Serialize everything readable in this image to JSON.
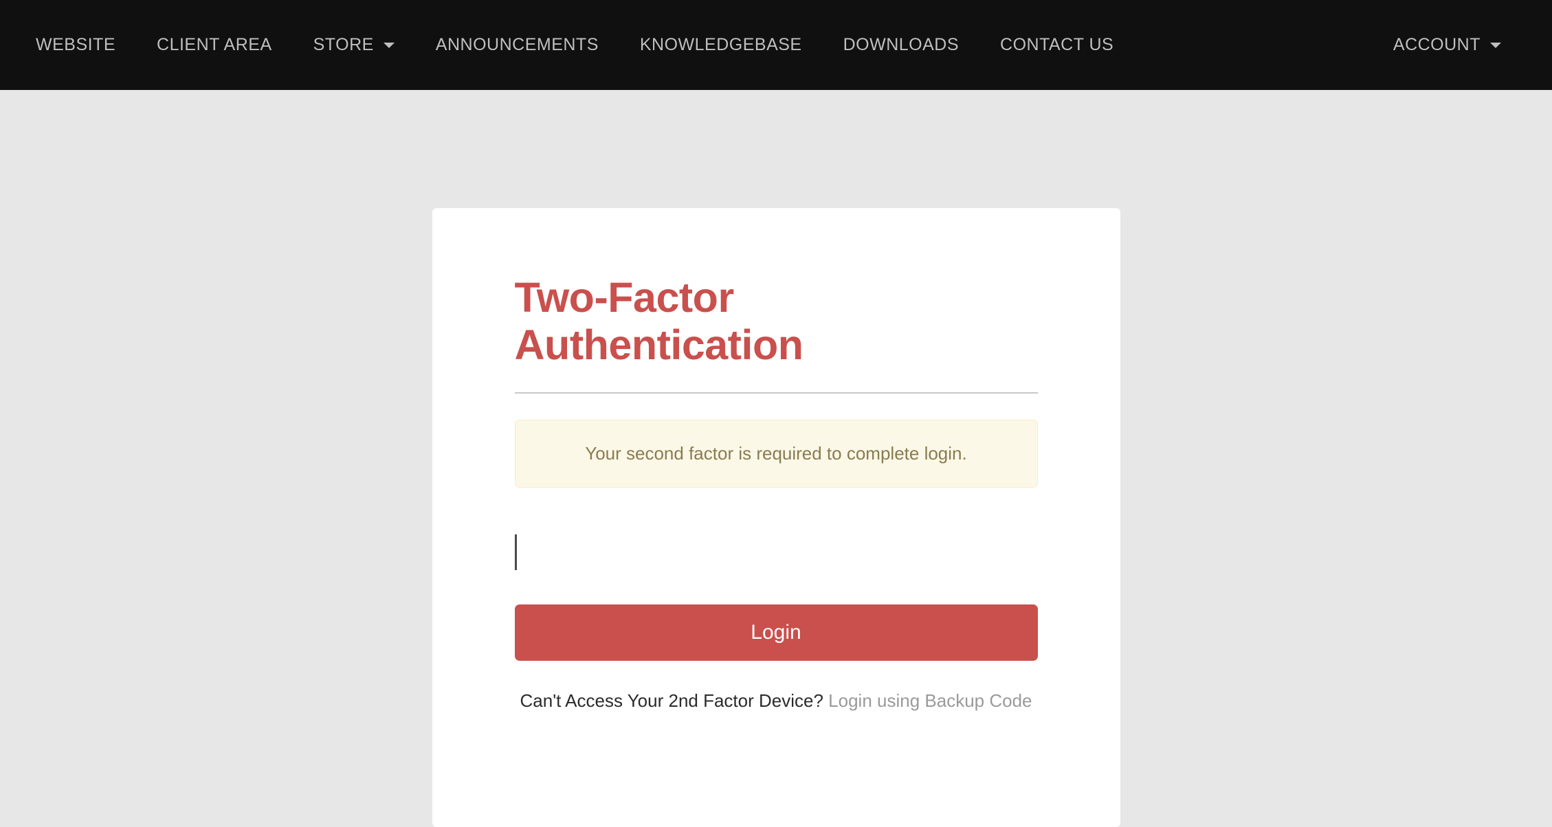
{
  "navbar": {
    "background_color": "#101010",
    "text_color": "#bfbfbf",
    "items": [
      {
        "label": "WEBSITE",
        "has_caret": false
      },
      {
        "label": "CLIENT AREA",
        "has_caret": false
      },
      {
        "label": "STORE",
        "has_caret": true
      },
      {
        "label": "ANNOUNCEMENTS",
        "has_caret": false
      },
      {
        "label": "KNOWLEDGEBASE",
        "has_caret": false
      },
      {
        "label": "DOWNLOADS",
        "has_caret": false
      },
      {
        "label": "CONTACT US",
        "has_caret": false
      }
    ],
    "account": {
      "label": "ACCOUNT",
      "has_caret": true
    }
  },
  "card": {
    "title": "Two-Factor Authentication",
    "alert": {
      "message": "Your second factor is required to complete login.",
      "background_color": "#fcf8e7",
      "border_color": "#f7ecc9",
      "text_color": "#8a7b50"
    },
    "input": {
      "value": "",
      "placeholder": ""
    },
    "login_button": {
      "label": "Login",
      "background_color": "#c9504d",
      "text_color": "#ffffff"
    },
    "footer": {
      "question": "Can't Access Your 2nd Factor Device?",
      "link_label": "Login using Backup Code",
      "link_color": "#9a9a9a"
    },
    "accent_color": "#c9504d",
    "background_color": "#ffffff"
  },
  "page": {
    "background_color": "#e7e7e7"
  }
}
